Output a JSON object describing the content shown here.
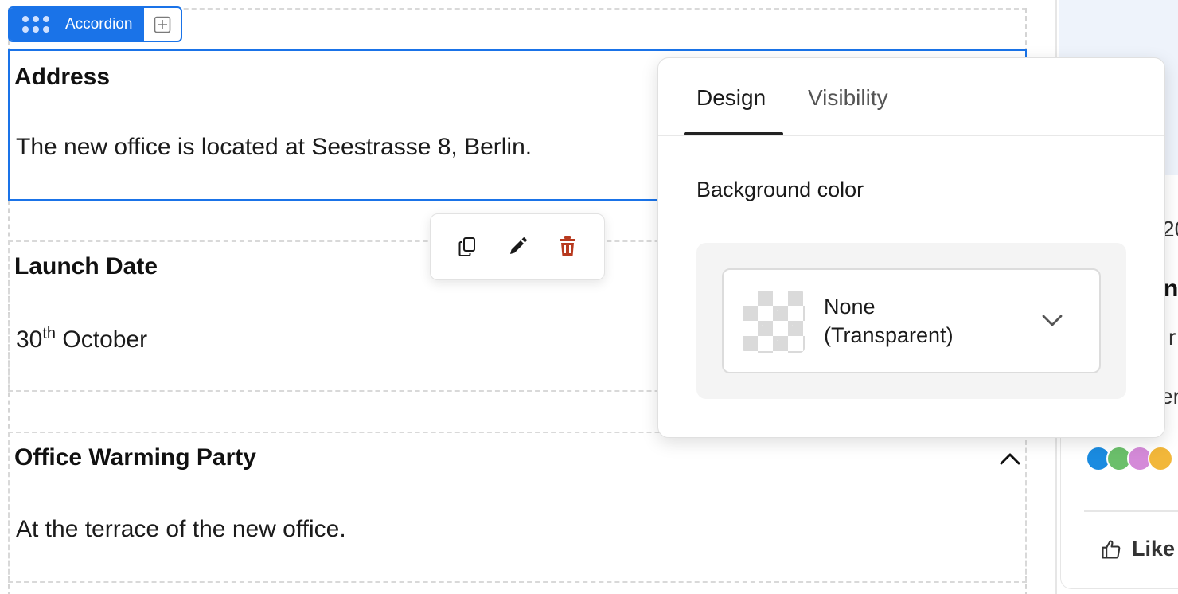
{
  "block_toolbar": {
    "label": "Accordion"
  },
  "accordion": [
    {
      "title": "Address",
      "body": "The new office is located at Seestrasse 8, Berlin."
    },
    {
      "title": "Launch Date",
      "body_prefix": "30",
      "body_sup": "th",
      "body_suffix": " October"
    },
    {
      "title": "Office Warming Party",
      "body": "At the terrace of the new office."
    }
  ],
  "mini_toolbar": {
    "icons": [
      "copy-icon",
      "pencil-icon",
      "trash-icon"
    ]
  },
  "settings": {
    "tabs": [
      "Design",
      "Visibility"
    ],
    "active_tab": "Design",
    "background_label": "Background color",
    "background_value_line1": "None",
    "background_value_line2": "(Transparent)"
  },
  "right_panel": {
    "fragment_date": "20",
    "fragment_title": "n",
    "fragment_text1": "r",
    "fragment_text2": "er",
    "like_label": "Like"
  },
  "colors": {
    "accent": "#1a73e8",
    "trash": "#c0392b"
  }
}
